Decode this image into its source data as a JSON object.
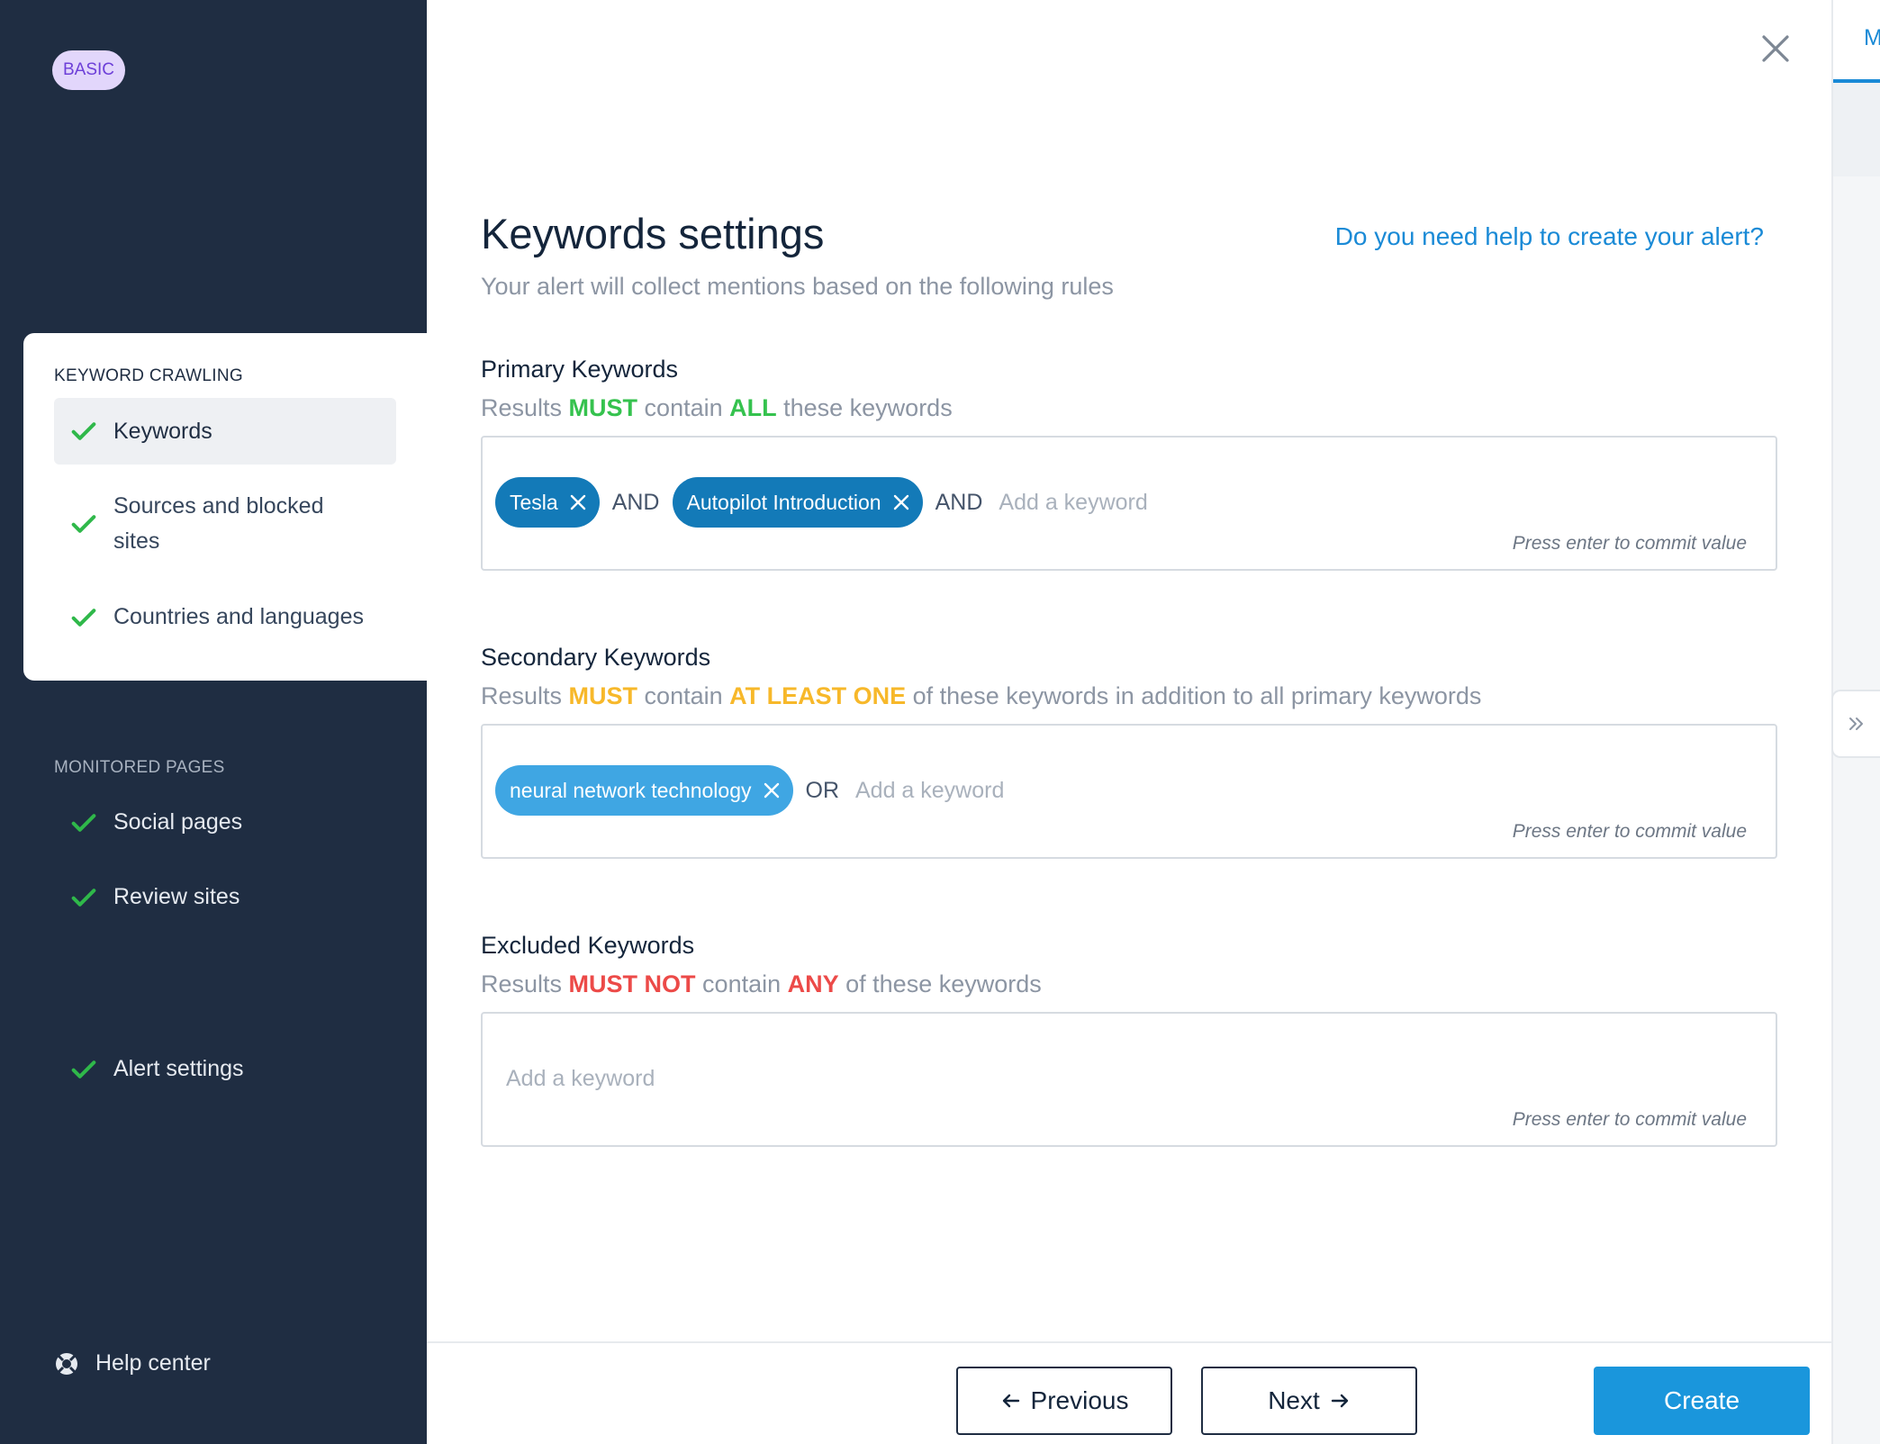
{
  "sidebar": {
    "plan_badge": "BASIC",
    "keyword_crawling": {
      "section_label": "KEYWORD CRAWLING",
      "items": [
        {
          "label": "Keywords",
          "status": "complete",
          "active": true
        },
        {
          "label": "Sources and blocked sites",
          "status": "complete",
          "active": false
        },
        {
          "label": "Countries and languages",
          "status": "complete",
          "active": false
        }
      ]
    },
    "monitored_pages": {
      "section_label": "MONITORED PAGES",
      "items": [
        {
          "label": "Social pages",
          "status": "complete"
        },
        {
          "label": "Review sites",
          "status": "complete"
        }
      ]
    },
    "alert_settings": {
      "label": "Alert settings",
      "status": "complete"
    },
    "help_center": {
      "label": "Help center",
      "icon": "lifebuoy-icon"
    }
  },
  "main": {
    "title": "Keywords settings",
    "subtitle": "Your alert will collect mentions based on the following rules",
    "help_link": "Do you need help to create your alert?",
    "primary": {
      "title": "Primary Keywords",
      "rule": {
        "t1": "Results ",
        "e1": "MUST",
        "t2": " contain ",
        "e2": "ALL",
        "t3": " these keywords"
      },
      "chips": [
        "Tesla",
        "Autopilot Introduction"
      ],
      "joiner": "AND",
      "placeholder": "Add a keyword",
      "hint": "Press enter to commit value"
    },
    "secondary": {
      "title": "Secondary Keywords",
      "rule": {
        "t1": "Results ",
        "e1": "MUST",
        "t2": " contain ",
        "e2": "AT LEAST ONE",
        "t3": " of these keywords in addition to all primary keywords"
      },
      "chips": [
        "neural network technology"
      ],
      "joiner": "OR",
      "placeholder": "Add a keyword",
      "hint": "Press enter to commit value"
    },
    "excluded": {
      "title": "Excluded Keywords",
      "rule": {
        "t1": "Results ",
        "e1": "MUST NOT",
        "t2": " contain ",
        "e2": "ANY",
        "t3": " of these keywords"
      },
      "chips": [],
      "placeholder": "Add a keyword",
      "hint": "Press enter to commit value"
    }
  },
  "footer": {
    "previous_label": "Previous",
    "next_label": "Next",
    "create_label": "Create"
  },
  "right_strip": {
    "tab_label": "M"
  },
  "colors": {
    "sidebar_bg": "#1f2d42",
    "accent_blue": "#1a96dc",
    "chip_dark": "#137ab8",
    "chip_light": "#3fa6e3",
    "check_green": "#2fb84a",
    "must_green": "#35c24e",
    "must_yellow": "#f7b82a",
    "must_red": "#ec4a48",
    "badge_bg": "#e2d6fb",
    "badge_text": "#6d3fd8"
  }
}
